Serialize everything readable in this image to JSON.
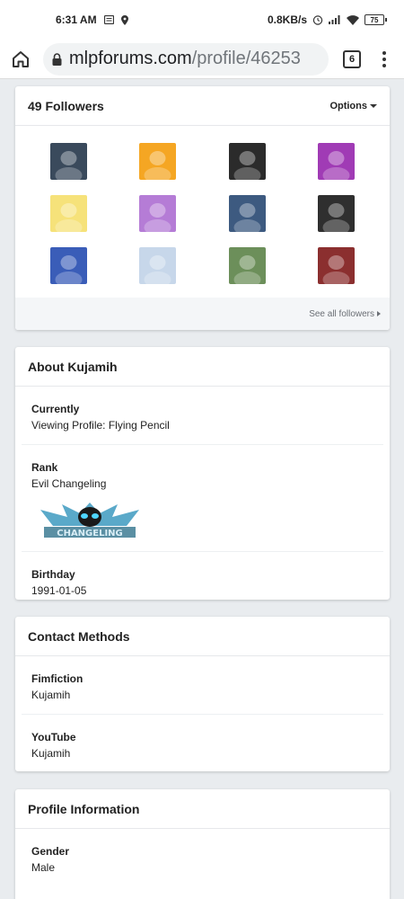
{
  "status_bar": {
    "time": "6:31 AM",
    "net_speed": "0.8KB/s",
    "battery": "75"
  },
  "browser": {
    "url_host": "mlpforums.com",
    "url_path": "/profile/46253",
    "tab_count": "6"
  },
  "followers": {
    "title": "49 Followers",
    "options_label": "Options",
    "see_all_label": "See all followers",
    "avatars": [
      {
        "color": "#3a4a5c"
      },
      {
        "color": "#f5a623"
      },
      {
        "color": "#2b2b2b"
      },
      {
        "color": "#a03bb5"
      },
      {
        "color": "#f6e27a"
      },
      {
        "color": "#b57cd6"
      },
      {
        "color": "#3d5a80"
      },
      {
        "color": "#2f2f2f"
      },
      {
        "color": "#3a5db8"
      },
      {
        "color": "#c7d7ea"
      },
      {
        "color": "#6c8f5a"
      },
      {
        "color": "#8b2f2f"
      }
    ]
  },
  "about": {
    "title": "About Kujamih",
    "fields": [
      {
        "label": "Currently",
        "value": "Viewing Profile: Flying Pencil"
      },
      {
        "label": "Rank",
        "value": "Evil Changeling",
        "badge_text": "CHANGELING"
      },
      {
        "label": "Birthday",
        "value": "1991-01-05"
      }
    ]
  },
  "contact": {
    "title": "Contact Methods",
    "fields": [
      {
        "label": "Fimfiction",
        "value": "Kujamih"
      },
      {
        "label": "YouTube",
        "value": "Kujamih"
      }
    ]
  },
  "profile_info": {
    "title": "Profile Information",
    "fields": [
      {
        "label": "Gender",
        "value": "Male"
      }
    ]
  }
}
